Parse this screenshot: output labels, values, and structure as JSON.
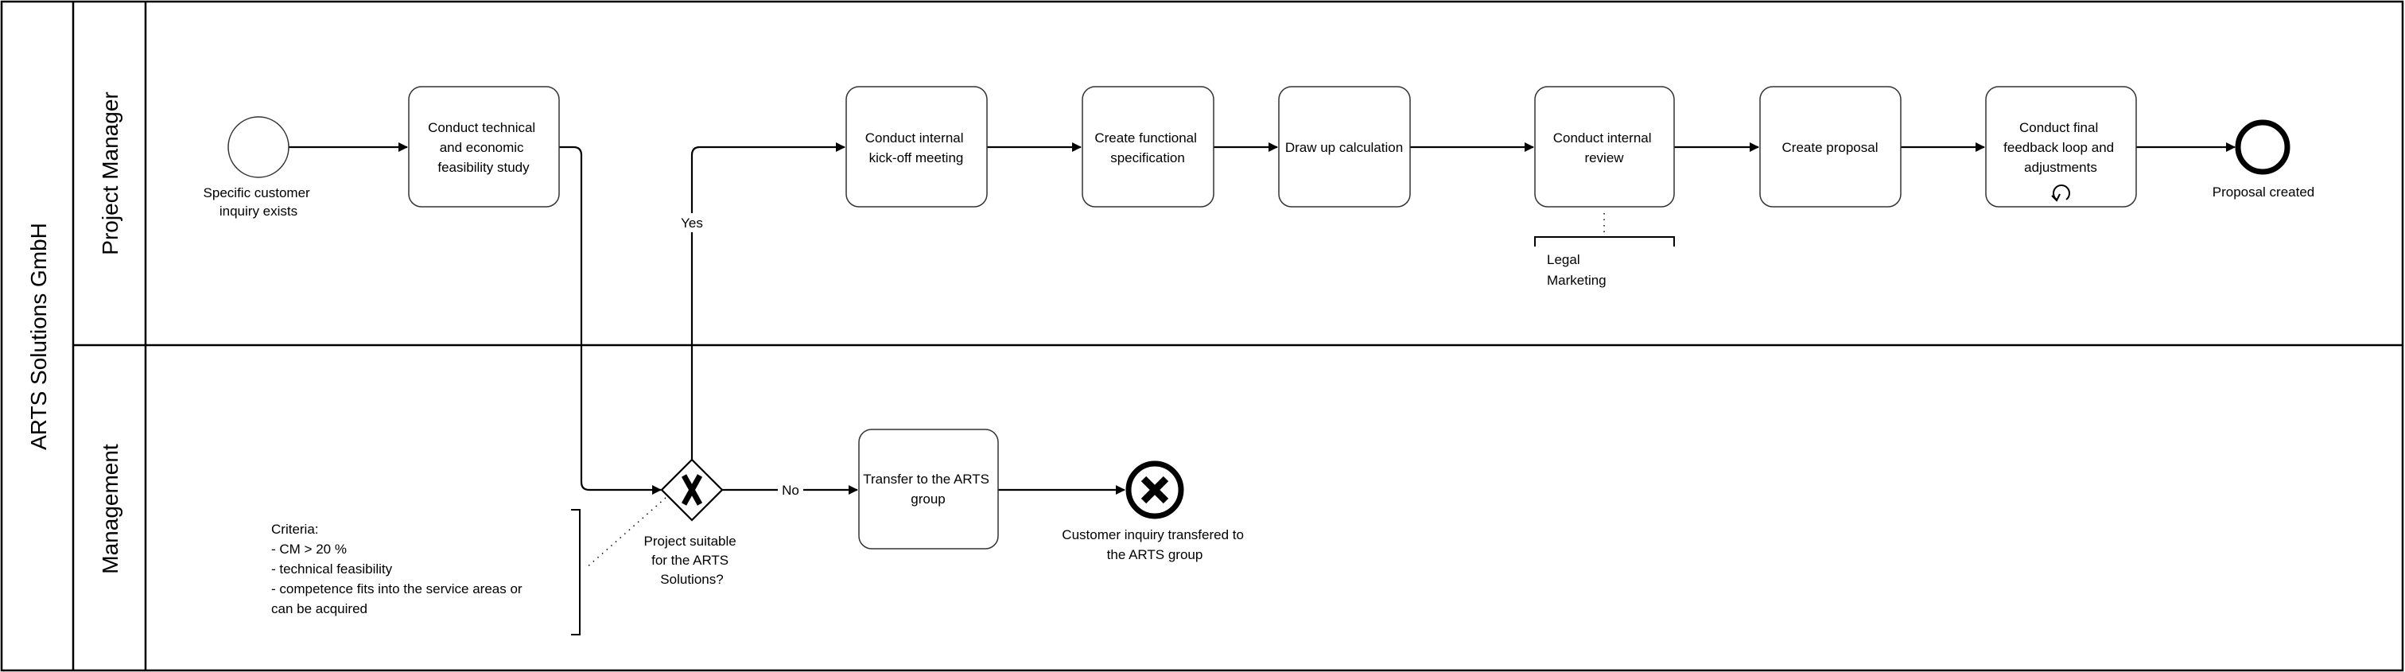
{
  "pool": {
    "title": "ARTS Solutions GmbH",
    "lanes": [
      {
        "id": "pm",
        "title": "Project Manager"
      },
      {
        "id": "mgmt",
        "title": "Management"
      }
    ]
  },
  "events": {
    "start": {
      "label_lines": [
        "Specific customer",
        "inquiry exists"
      ],
      "type": "start"
    },
    "end_proposal": {
      "label_lines": [
        "Proposal created"
      ],
      "type": "end"
    },
    "end_transfer": {
      "label_lines": [
        "Customer inquiry transfered to",
        "the ARTS group"
      ],
      "type": "end-cancel"
    }
  },
  "tasks": [
    {
      "id": "feasibility",
      "lane": "pm",
      "lines": [
        "Conduct technical",
        "and economic",
        "feasibility study"
      ]
    },
    {
      "id": "kickoff",
      "lane": "pm",
      "lines": [
        "Conduct internal",
        "kick-off meeting"
      ]
    },
    {
      "id": "spec",
      "lane": "pm",
      "lines": [
        "Create functional",
        "specification"
      ]
    },
    {
      "id": "calc",
      "lane": "pm",
      "lines": [
        "Draw up calculation"
      ]
    },
    {
      "id": "review",
      "lane": "pm",
      "lines": [
        "Conduct internal",
        "review"
      ]
    },
    {
      "id": "proposal",
      "lane": "pm",
      "lines": [
        "Create proposal"
      ]
    },
    {
      "id": "feedback",
      "lane": "pm",
      "lines": [
        "Conduct final",
        "feedback loop and",
        "adjustments"
      ],
      "marker": "loop"
    },
    {
      "id": "transfer",
      "lane": "mgmt",
      "lines": [
        "Transfer to the ARTS",
        "group"
      ]
    }
  ],
  "gateway": {
    "type": "exclusive",
    "label_lines": [
      "Project suitable",
      "for the ARTS",
      "Solutions?"
    ],
    "yes_label": "Yes",
    "no_label": "No"
  },
  "annotations": {
    "review": {
      "lines": [
        "Legal",
        "Marketing"
      ]
    },
    "criteria": {
      "lines": [
        "Criteria:",
        "- CM > 20 %",
        "- technical feasibility",
        "- competence fits into the service areas or",
        "can be acquired"
      ]
    }
  }
}
